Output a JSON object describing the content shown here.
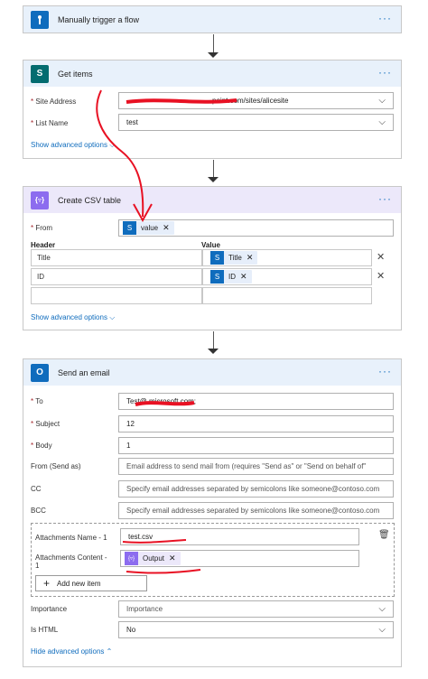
{
  "trigger": {
    "title": "Manually trigger a flow"
  },
  "get_items": {
    "title": "Get items",
    "site_address_label": "Site Address",
    "site_address_value": "point.com/sites/alicesite",
    "list_name_label": "List Name",
    "list_name_value": "test",
    "advanced": "Show advanced options"
  },
  "csv": {
    "title": "Create CSV table",
    "from_label": "From",
    "from_token": "value",
    "header_col": "Header",
    "value_col": "Value",
    "rows": [
      {
        "header": "Title",
        "value": "Title"
      },
      {
        "header": "ID",
        "value": "ID"
      }
    ],
    "advanced": "Show advanced options"
  },
  "email": {
    "title": "Send an email",
    "to_label": "To",
    "to_value": "Test@ microsoft.com;",
    "subject_label": "Subject",
    "subject_value": "12",
    "body_label": "Body",
    "body_value": "1",
    "from_label": "From (Send as)",
    "from_placeholder": "Email address to send mail from (requires \"Send as\" or \"Send on behalf of\"",
    "cc_label": "CC",
    "cc_placeholder": "Specify email addresses separated by semicolons like someone@contoso.com",
    "bcc_label": "BCC",
    "bcc_placeholder": "Specify email addresses separated by semicolons like someone@contoso.com",
    "attach_name_label": "Attachments Name - 1",
    "attach_name_value": "test.csv",
    "attach_content_label": "Attachments Content -",
    "attach_content_label2": "1",
    "attach_content_token": "Output",
    "add_item": "Add new item",
    "importance_label": "Importance",
    "importance_value": "Importance",
    "is_html_label": "Is HTML",
    "is_html_value": "No",
    "hide_advanced": "Hide advanced options"
  },
  "symbols": {
    "dots": "···",
    "chevron_down": "⌵",
    "close": "✕",
    "plus": "+"
  },
  "colors": {
    "accent": "#0f6cbd",
    "outlook": "#0f6cbd",
    "sharepoint": "#036c70",
    "csv": "#8c6cef",
    "annotation": "#e81123"
  }
}
